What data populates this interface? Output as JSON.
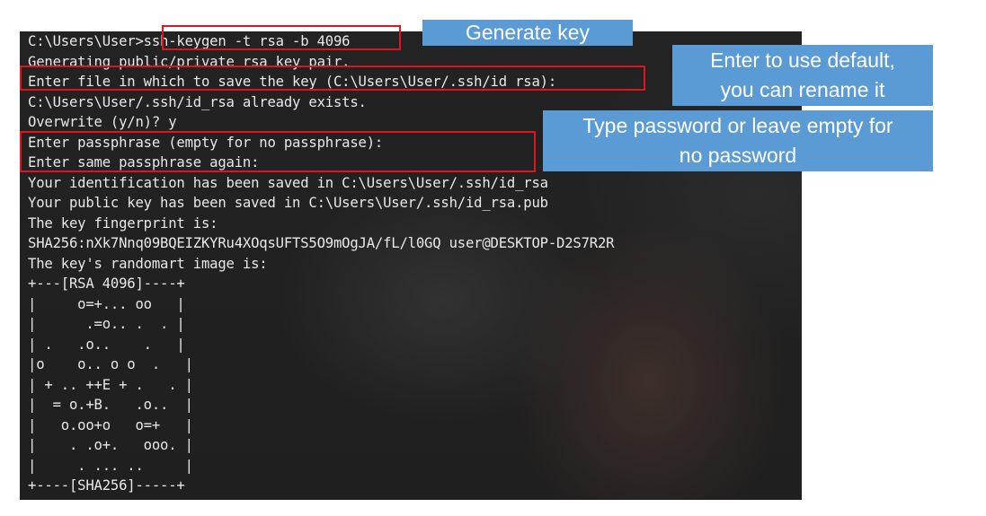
{
  "terminal": {
    "lines": [
      "C:\\Users\\User>ssh-keygen -t rsa -b 4096",
      "Generating public/private rsa key pair.",
      "Enter file in which to save the key (C:\\Users\\User/.ssh/id_rsa):",
      "C:\\Users\\User/.ssh/id_rsa already exists.",
      "Overwrite (y/n)? y",
      "Enter passphrase (empty for no passphrase):",
      "Enter same passphrase again:",
      "Your identification has been saved in C:\\Users\\User/.ssh/id_rsa",
      "Your public key has been saved in C:\\Users\\User/.ssh/id_rsa.pub",
      "The key fingerprint is:",
      "SHA256:nXk7Nnq09BQEIZKYRu4XOqsUFTS5O9mOgJA/fL/l0GQ user@DESKTOP-D2S7R2R",
      "The key's randomart image is:",
      "+---[RSA 4096]----+",
      "|     o=+... oo   |",
      "|      .=o.. .  . |",
      "| .   .o..    .   |",
      "|o    o.. o o  .   |",
      "| + .. ++E + .   . |",
      "|  = o.+B.   .o..  |",
      "|   o.oo+o   o=+   |",
      "|    . .o+.   ooo. |",
      "|     . ... ..     |",
      "+----[SHA256]-----+"
    ]
  },
  "callouts": {
    "generate": "Generate key",
    "default_line1": "Enter to use default,",
    "default_line2": "you can rename it",
    "password_line1": "Type password or leave empty for",
    "password_line2": "no password"
  },
  "colors": {
    "terminal_bg": "#1f1f1f",
    "terminal_text": "#e8e8e8",
    "highlight_border": "#e0141c",
    "callout_bg": "#5b9bd5",
    "callout_text": "#ffffff"
  }
}
